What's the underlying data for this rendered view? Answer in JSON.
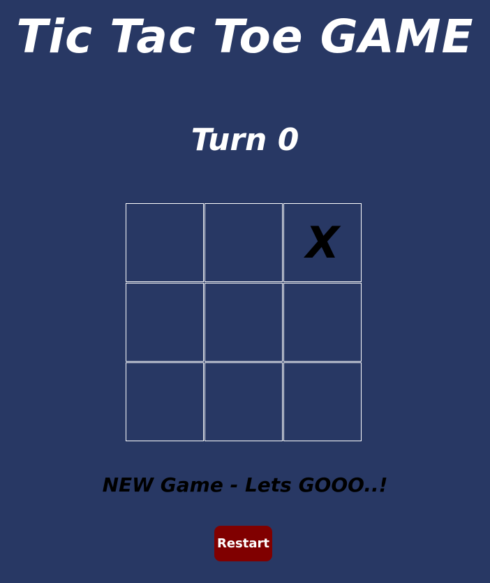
{
  "title": "Tic Tac Toe GAME",
  "turn_text": "Turn 0",
  "board": {
    "cells": [
      "",
      "",
      "X",
      "",
      "",
      "",
      "",
      "",
      ""
    ]
  },
  "status_message": "NEW Game - Lets GOOO..!",
  "restart_label": "Restart",
  "colors": {
    "background": "#283864",
    "text": "#ffffff",
    "mark": "#000000",
    "button": "#800000"
  }
}
